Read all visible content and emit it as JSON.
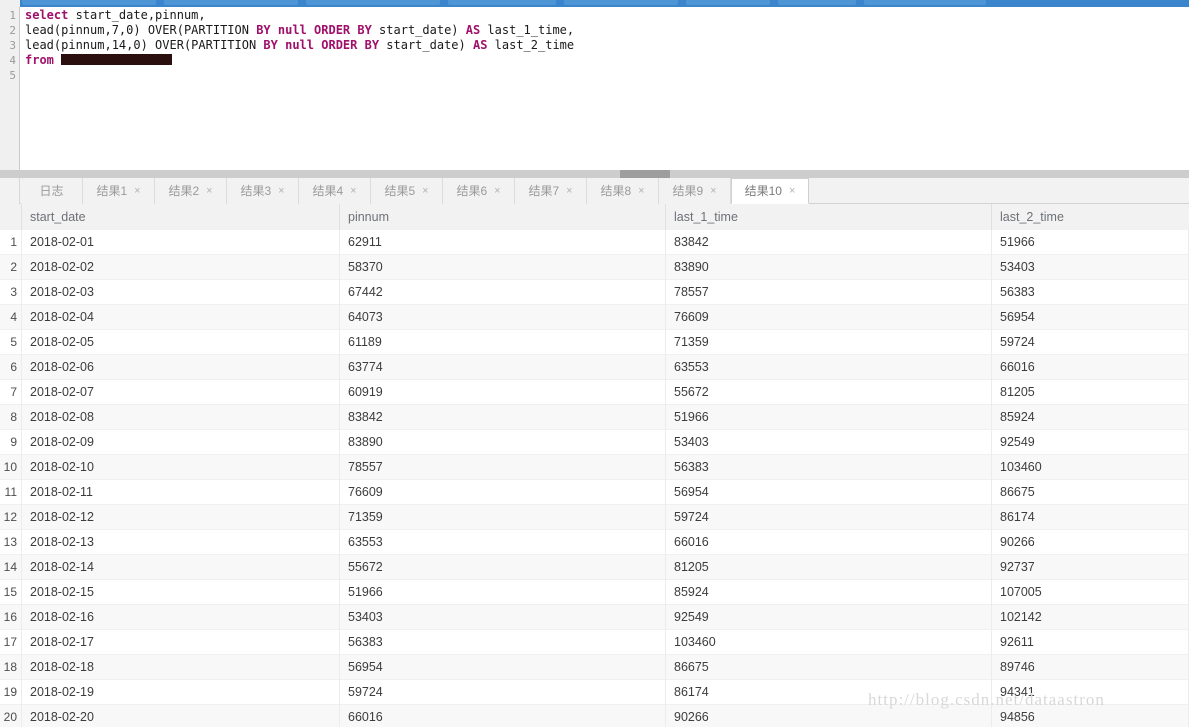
{
  "window": {
    "top_tabs_count": 8
  },
  "editor": {
    "line_numbers": [
      "1",
      "2",
      "3",
      "4",
      "5"
    ],
    "lines": [
      {
        "n": "1",
        "segments": [
          {
            "t": "select",
            "kw": true
          },
          {
            "t": " start_date,pinnum,",
            "kw": false
          }
        ]
      },
      {
        "n": "2",
        "segments": [
          {
            "t": "lead(pinnum,7,0) OVER(PARTITION ",
            "kw": false
          },
          {
            "t": "BY",
            "kw": true
          },
          {
            "t": " ",
            "kw": false
          },
          {
            "t": "null",
            "kw": true
          },
          {
            "t": " ",
            "kw": false
          },
          {
            "t": "ORDER",
            "kw": true
          },
          {
            "t": " ",
            "kw": false
          },
          {
            "t": "BY",
            "kw": true
          },
          {
            "t": " start_date) ",
            "kw": false
          },
          {
            "t": "AS",
            "kw": true
          },
          {
            "t": " last_1_time,",
            "kw": false
          }
        ]
      },
      {
        "n": "3",
        "segments": [
          {
            "t": "lead(pinnum,14,0) OVER(PARTITION ",
            "kw": false
          },
          {
            "t": "BY",
            "kw": true
          },
          {
            "t": " ",
            "kw": false
          },
          {
            "t": "null",
            "kw": true
          },
          {
            "t": " ",
            "kw": false
          },
          {
            "t": "ORDER",
            "kw": true
          },
          {
            "t": " ",
            "kw": false
          },
          {
            "t": "BY",
            "kw": true
          },
          {
            "t": " start_date) ",
            "kw": false
          },
          {
            "t": "AS",
            "kw": true
          },
          {
            "t": " last_2_time",
            "kw": false
          }
        ]
      },
      {
        "n": "4",
        "segments": [
          {
            "t": "from",
            "kw": true
          },
          {
            "t": " ",
            "kw": false
          },
          {
            "t": "",
            "redacted": true,
            "width": 111
          }
        ]
      },
      {
        "n": "5",
        "segments": []
      }
    ],
    "keyword_color": "#a0106a",
    "text_color": "#1a1a1a"
  },
  "tabs": {
    "items": [
      {
        "label": "日志",
        "closable": false,
        "active": false
      },
      {
        "label": "结果1",
        "closable": true,
        "active": false
      },
      {
        "label": "结果2",
        "closable": true,
        "active": false
      },
      {
        "label": "结果3",
        "closable": true,
        "active": false
      },
      {
        "label": "结果4",
        "closable": true,
        "active": false
      },
      {
        "label": "结果5",
        "closable": true,
        "active": false
      },
      {
        "label": "结果6",
        "closable": true,
        "active": false
      },
      {
        "label": "结果7",
        "closable": true,
        "active": false
      },
      {
        "label": "结果8",
        "closable": true,
        "active": false
      },
      {
        "label": "结果9",
        "closable": true,
        "active": false
      },
      {
        "label": "结果10",
        "closable": true,
        "active": true
      }
    ],
    "close_glyph": "×"
  },
  "grid": {
    "columns": [
      "start_date",
      "pinnum",
      "last_1_time",
      "last_2_time"
    ],
    "rows": [
      {
        "n": "1",
        "cells": [
          "2018-02-01",
          "62911",
          "83842",
          "51966"
        ]
      },
      {
        "n": "2",
        "cells": [
          "2018-02-02",
          "58370",
          "83890",
          "53403"
        ]
      },
      {
        "n": "3",
        "cells": [
          "2018-02-03",
          "67442",
          "78557",
          "56383"
        ]
      },
      {
        "n": "4",
        "cells": [
          "2018-02-04",
          "64073",
          "76609",
          "56954"
        ]
      },
      {
        "n": "5",
        "cells": [
          "2018-02-05",
          "61189",
          "71359",
          "59724"
        ]
      },
      {
        "n": "6",
        "cells": [
          "2018-02-06",
          "63774",
          "63553",
          "66016"
        ]
      },
      {
        "n": "7",
        "cells": [
          "2018-02-07",
          "60919",
          "55672",
          "81205"
        ]
      },
      {
        "n": "8",
        "cells": [
          "2018-02-08",
          "83842",
          "51966",
          "85924"
        ]
      },
      {
        "n": "9",
        "cells": [
          "2018-02-09",
          "83890",
          "53403",
          "92549"
        ]
      },
      {
        "n": "10",
        "cells": [
          "2018-02-10",
          "78557",
          "56383",
          "103460"
        ]
      },
      {
        "n": "11",
        "cells": [
          "2018-02-11",
          "76609",
          "56954",
          "86675"
        ]
      },
      {
        "n": "12",
        "cells": [
          "2018-02-12",
          "71359",
          "59724",
          "86174"
        ]
      },
      {
        "n": "13",
        "cells": [
          "2018-02-13",
          "63553",
          "66016",
          "90266"
        ]
      },
      {
        "n": "14",
        "cells": [
          "2018-02-14",
          "55672",
          "81205",
          "92737"
        ]
      },
      {
        "n": "15",
        "cells": [
          "2018-02-15",
          "51966",
          "85924",
          "107005"
        ]
      },
      {
        "n": "16",
        "cells": [
          "2018-02-16",
          "53403",
          "92549",
          "102142"
        ]
      },
      {
        "n": "17",
        "cells": [
          "2018-02-17",
          "56383",
          "103460",
          "92611"
        ]
      },
      {
        "n": "18",
        "cells": [
          "2018-02-18",
          "56954",
          "86675",
          "89746"
        ]
      },
      {
        "n": "19",
        "cells": [
          "2018-02-19",
          "59724",
          "86174",
          "94341"
        ]
      },
      {
        "n": "20",
        "cells": [
          "2018-02-20",
          "66016",
          "90266",
          "94856"
        ]
      }
    ]
  },
  "watermark": {
    "text": "http://blog.csdn.net/dataastron"
  }
}
